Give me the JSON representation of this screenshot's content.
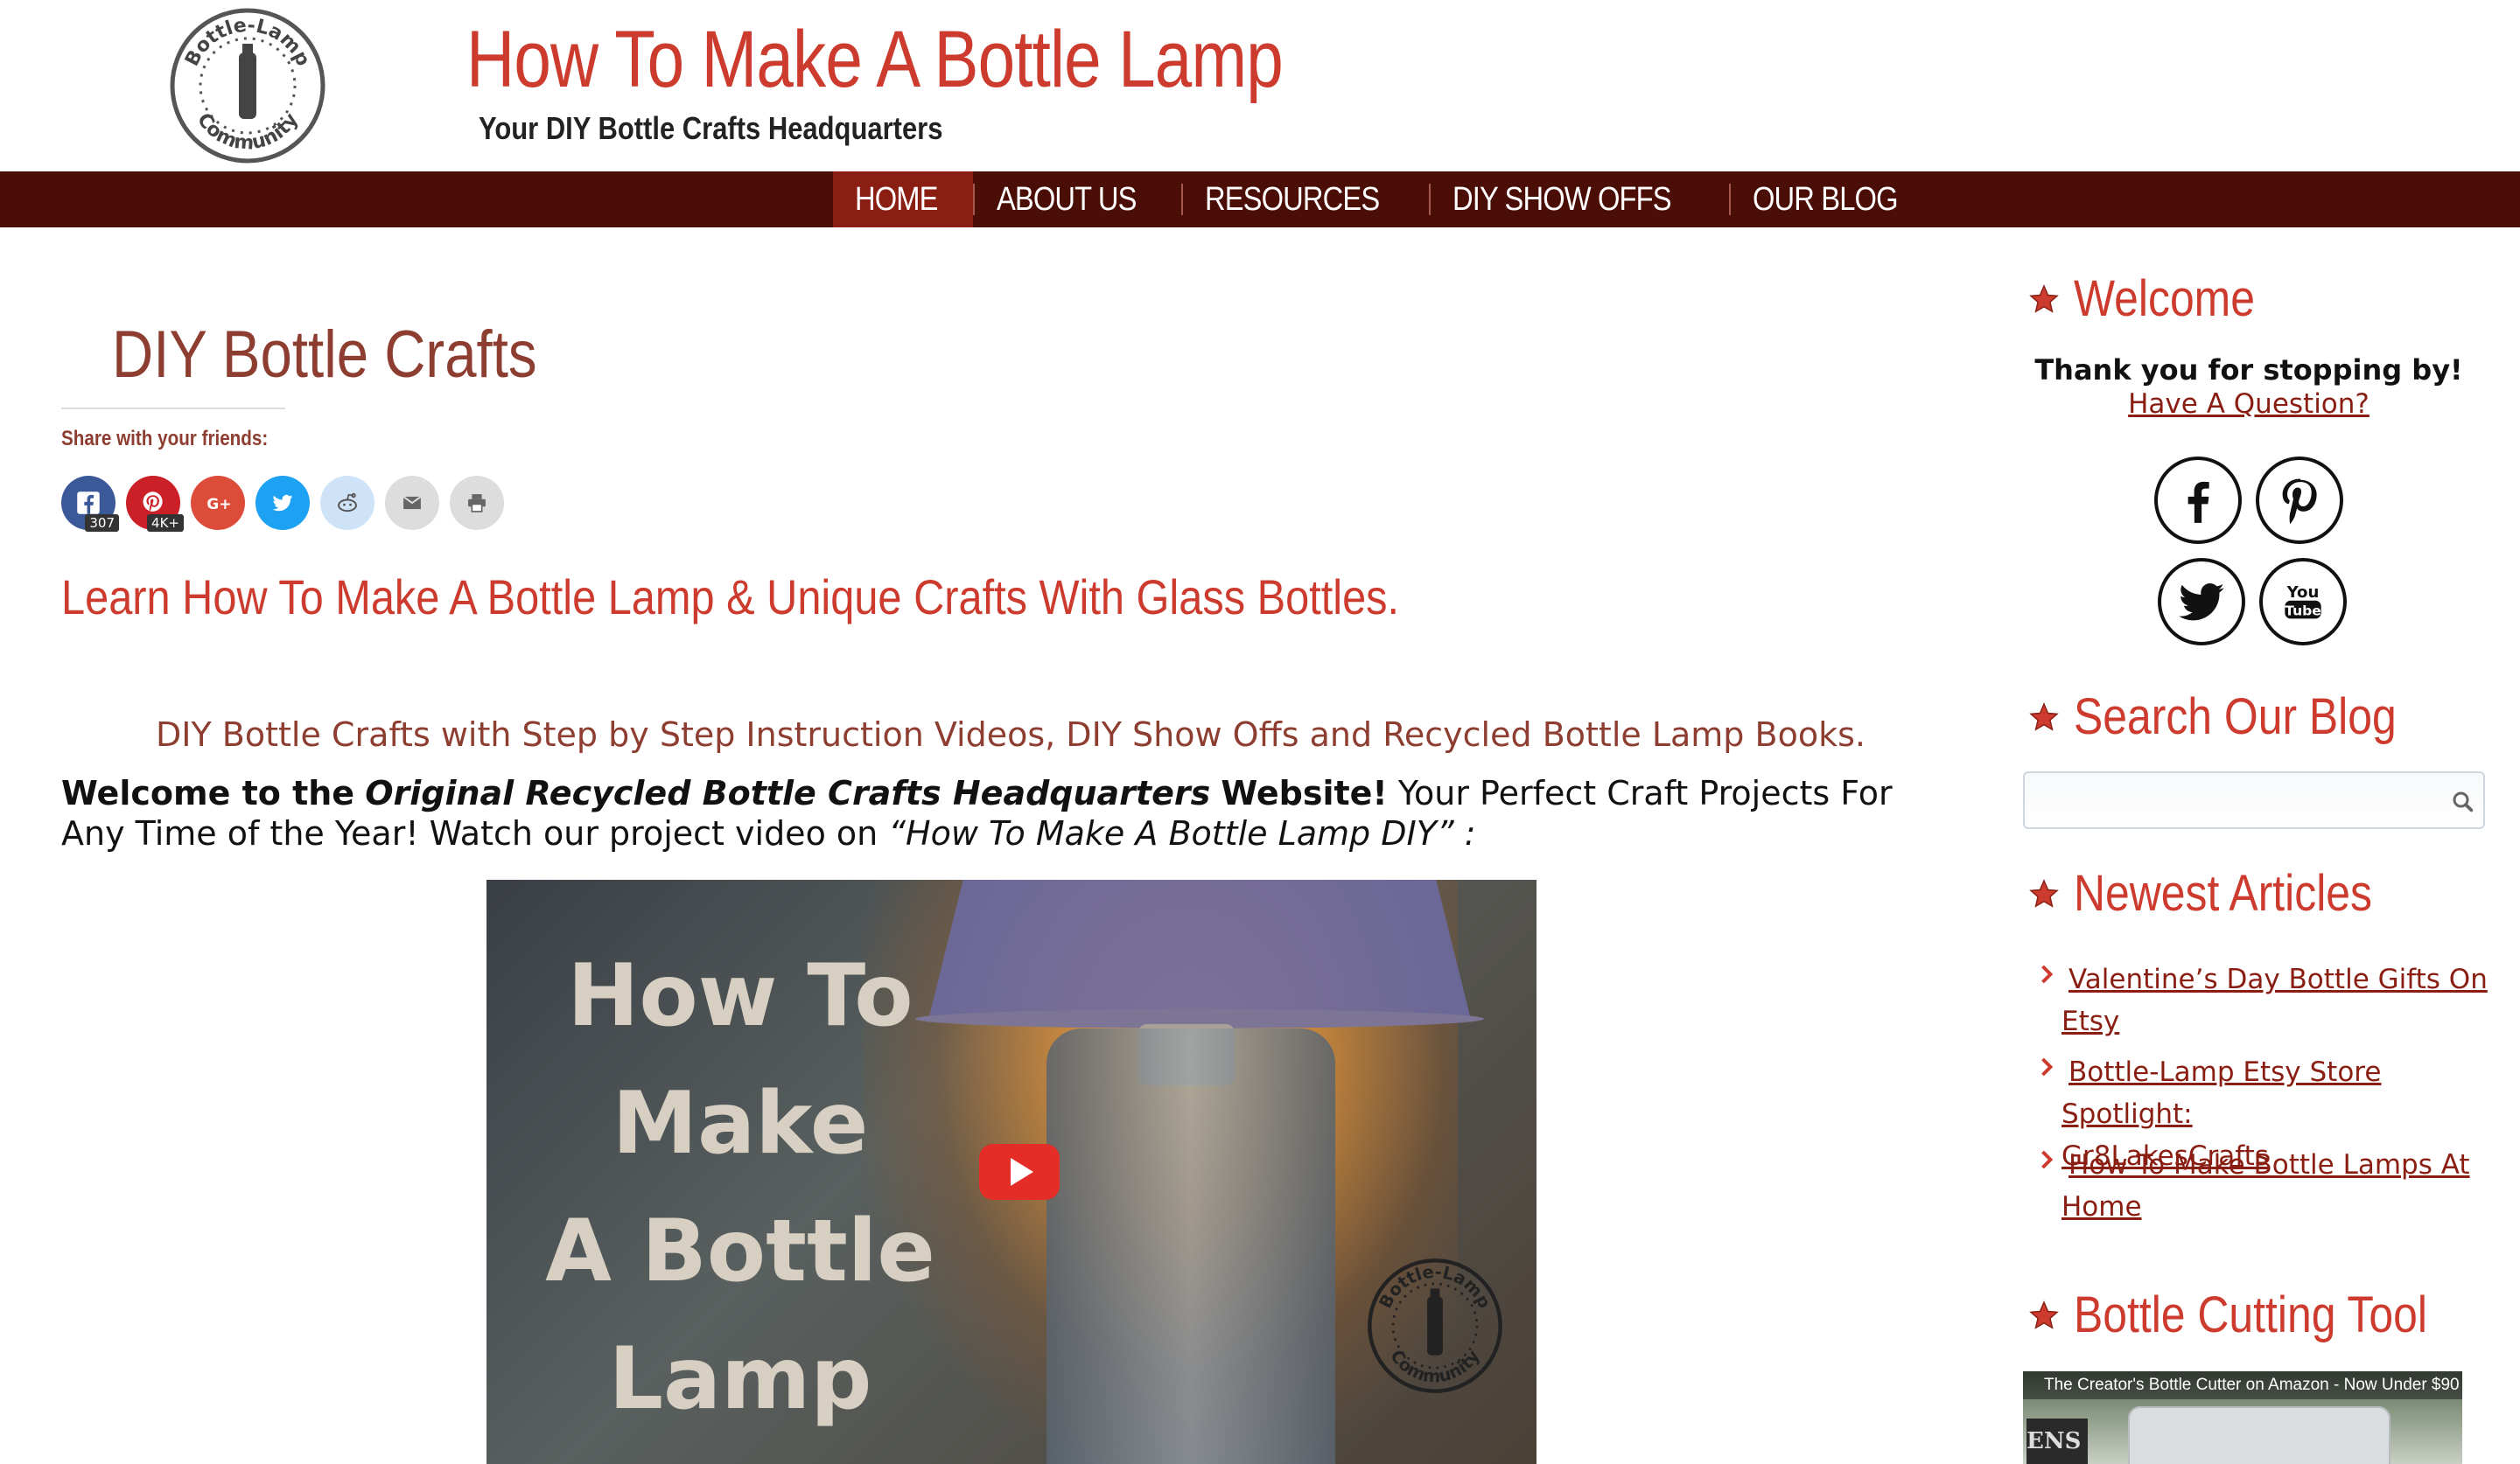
{
  "site": {
    "title": "How To Make A Bottle Lamp",
    "tagline": "Your DIY Bottle Crafts Headquarters",
    "logo_text_top": "Bottle-Lamp",
    "logo_text_bottom": "Community"
  },
  "nav": {
    "items": [
      {
        "label": "HOME",
        "active": true
      },
      {
        "label": "ABOUT US",
        "active": false
      },
      {
        "label": "RESOURCES",
        "active": false
      },
      {
        "label": "DIY SHOW OFFS",
        "active": false
      },
      {
        "label": "OUR BLOG",
        "active": false
      }
    ]
  },
  "main": {
    "page_title": "DIY Bottle Crafts",
    "share_label": "Share with your friends:",
    "share_buttons": [
      {
        "icon": "facebook-icon",
        "color": "#3b5998",
        "count": "307"
      },
      {
        "icon": "pinterest-icon",
        "color": "#cb2027",
        "count": "4K+"
      },
      {
        "icon": "google-plus-icon",
        "color": "#dd4b39",
        "count": ""
      },
      {
        "icon": "twitter-icon",
        "color": "#1da1f2",
        "count": ""
      },
      {
        "icon": "reddit-icon",
        "color": "#cee3f8",
        "count": ""
      },
      {
        "icon": "email-icon",
        "color": "#dddddd",
        "count": ""
      },
      {
        "icon": "print-icon",
        "color": "#dddddd",
        "count": ""
      }
    ],
    "intro_heading": "Learn How To Make A Bottle Lamp & Unique Crafts With Glass Bottles.",
    "sub_heading": "DIY Bottle Crafts with Step by Step Instruction Videos, DIY Show Offs and Recycled Bottle Lamp Books.",
    "welcome": {
      "bold_start": "Welcome to the",
      "italic_name": "Original Recycled Bottle Crafts Headquarters",
      "bold_end": "Website!",
      "rest": "Your Perfect Craft Projects For Any Time of the Year! Watch our project video on",
      "video_name": "“How To Make A Bottle Lamp DIY” :"
    },
    "video": {
      "title_lines": [
        "How To",
        "Make",
        "A Bottle",
        "Lamp"
      ],
      "logo_text_top": "Bottle-Lamp",
      "logo_text_bottom": "Community"
    }
  },
  "sidebar": {
    "welcome": {
      "title": "Welcome",
      "thanks": "Thank you for stopping by!",
      "question_link": "Have A Question?",
      "social": [
        "facebook-icon",
        "pinterest-icon",
        "twitter-icon",
        "youtube-icon"
      ]
    },
    "search": {
      "title": "Search Our Blog",
      "placeholder": ""
    },
    "newest": {
      "title": "Newest Articles",
      "articles": [
        {
          "line1": "Valentine’s Day Bottle Gifts On",
          "line2": "Etsy"
        },
        {
          "line1": "Bottle-Lamp Etsy Store Spotlight:",
          "line2": "Gr8LakesCrafts"
        },
        {
          "line1": "How To Make Bottle Lamps At",
          "line2": "Home"
        }
      ]
    },
    "tool": {
      "title": "Bottle Cutting Tool",
      "caption": "The Creator's Bottle Cutter on Amazon - Now Under $90",
      "brand_text": "ENS"
    }
  },
  "colors": {
    "accent_red": "#cc3b2d",
    "nav_bg": "#4a0e07",
    "nav_active": "#8a1e12",
    "title_brown": "#8e3e31",
    "link": "#8a1e12"
  }
}
